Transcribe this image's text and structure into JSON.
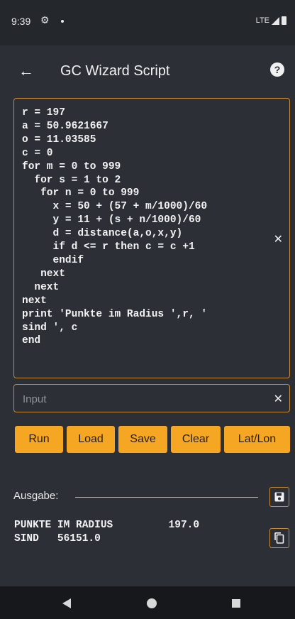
{
  "status_bar": {
    "time": "9:39",
    "network": "LTE"
  },
  "app_bar": {
    "title": "GC Wizard Script"
  },
  "script_editor": {
    "code": "r = 197\na = 50.9621667\no = 11.03585\nc = 0\nfor m = 0 to 999\n  for s = 1 to 2\n   for n = 0 to 999\n     x = 50 + (57 + m/1000)/60\n     y = 11 + (s + n/1000)/60\n     d = distance(a,o,x,y)\n     if d <= r then c = c +1\n     endif\n   next\n  next\nnext\nprint 'Punkte im Radius ',r, '\nsind ', c\nend"
  },
  "input": {
    "placeholder": "Input",
    "value": ""
  },
  "buttons": {
    "run": "Run",
    "load": "Load",
    "save": "Save",
    "clear": "Clear",
    "latlon": "Lat/Lon"
  },
  "output": {
    "label": "Ausgabe:",
    "text": "PUNKTE IM RADIUS         197.0\nSIND   56151.0"
  },
  "colors": {
    "accent": "#f5a623",
    "border": "#c88a35",
    "background": "#2c3036"
  },
  "icons": [
    "gear-icon",
    "back-arrow-icon",
    "help-icon",
    "clear-icon",
    "save-disk-icon",
    "copy-icon"
  ]
}
